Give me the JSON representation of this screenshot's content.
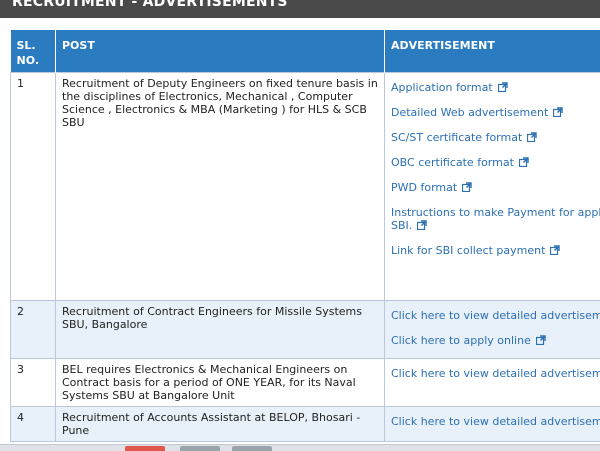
{
  "section": {
    "title": "RECRUITMENT - ADVERTISEMENTS"
  },
  "table": {
    "headers": {
      "sl": "SL.\nNO.",
      "post": "POST",
      "advertisement": "ADVERTISEMENT"
    },
    "rows": [
      {
        "sl": "1",
        "post": "Recruitment of Deputy Engineers on fixed tenure basis in the disciplines of Electronics, Mechanical , Computer Science , Electronics & MBA (Marketing ) for HLS & SCB SBU",
        "links": [
          "Application format",
          "Detailed Web advertisement",
          "SC/ST certificate format",
          "OBC certificate format",
          "PWD format",
          "Instructions to make Payment for appli thro SBI.",
          "Link for SBI collect payment"
        ]
      },
      {
        "sl": "2",
        "post": "Recruitment of Contract Engineers for Missile Systems SBU, Bangalore",
        "links": [
          "Click here to view detailed advertiseme",
          "Click here to apply online"
        ]
      },
      {
        "sl": "3",
        "post": "BEL requires Electronics & Mechanical Engineers on Contract basis for a period of ONE YEAR, for its Naval Systems SBU at Bangalore Unit",
        "links": [
          "Click here to view detailed advertiseme"
        ]
      },
      {
        "sl": "4",
        "post": "Recruitment of Accounts Assistant at BELOP, Bhosari - Pune",
        "links": [
          "Click here to view detailed advertiseme"
        ]
      }
    ]
  },
  "colors": {
    "header_blue": "#2b7bc0",
    "link_blue": "#2b6fb4",
    "row_alt": "#e8f1fa",
    "title_bar": "#4a4a4a"
  },
  "icons": {
    "external_link": "external-link-icon"
  }
}
